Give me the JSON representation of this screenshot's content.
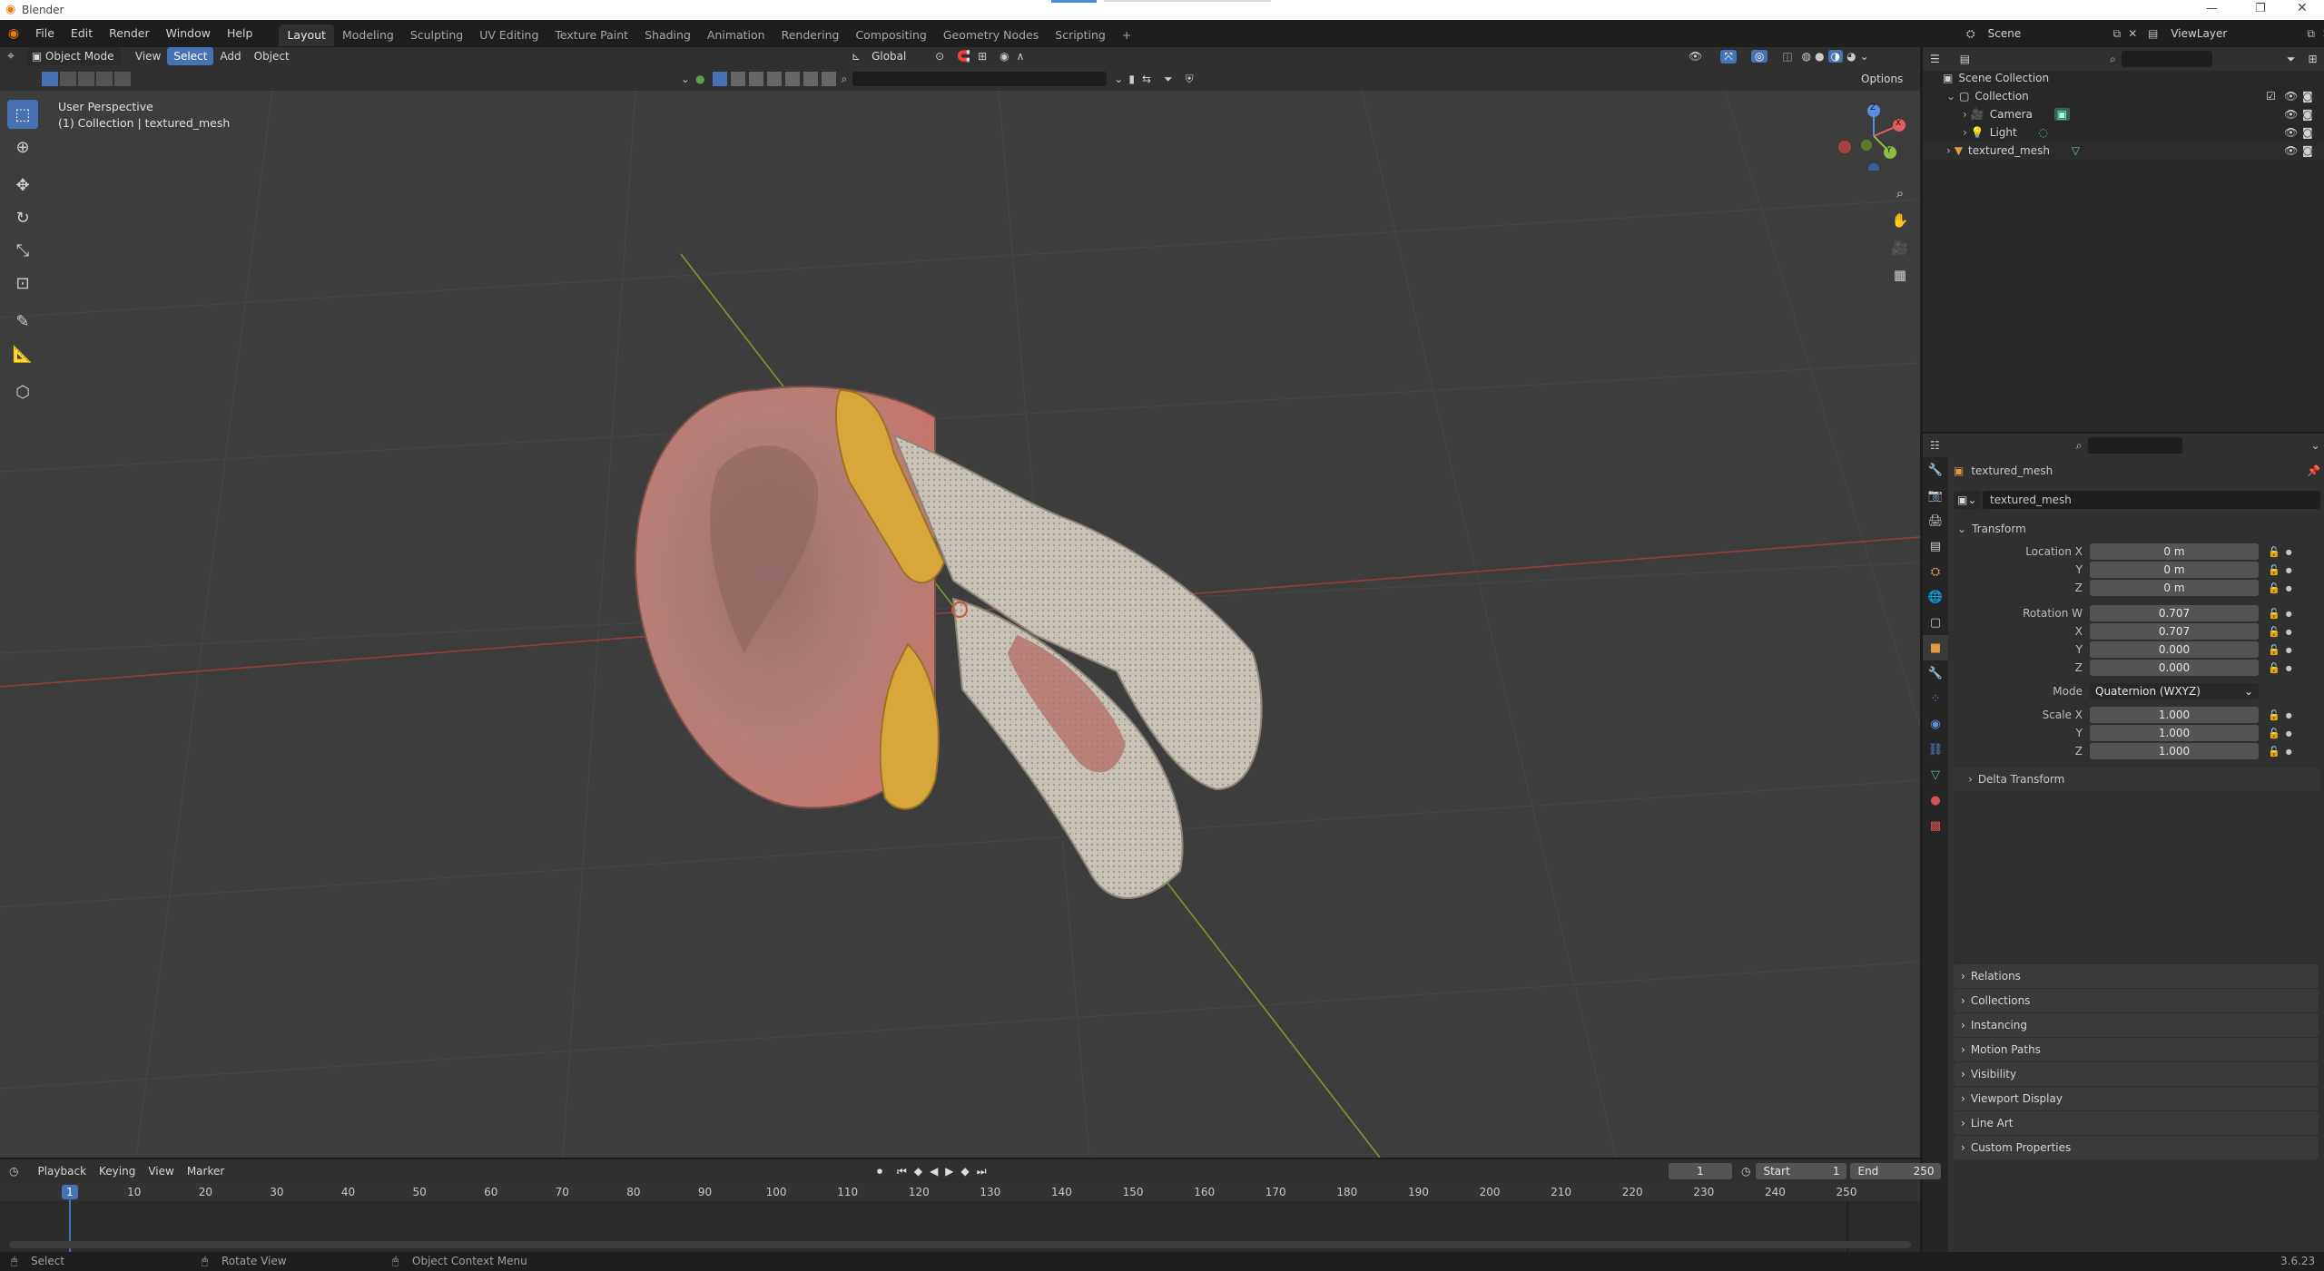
{
  "title_bar": {
    "app_name": "Blender"
  },
  "menu": {
    "items": [
      "File",
      "Edit",
      "Render",
      "Window",
      "Help"
    ]
  },
  "workspaces": {
    "tabs": [
      "Layout",
      "Modeling",
      "Sculpting",
      "UV Editing",
      "Texture Paint",
      "Shading",
      "Animation",
      "Rendering",
      "Compositing",
      "Geometry Nodes",
      "Scripting"
    ],
    "active": "Layout",
    "add_label": "+"
  },
  "scene": {
    "label": "Scene",
    "view_layer_label": "ViewLayer"
  },
  "viewport_header": {
    "mode": "Object Mode",
    "menus": [
      "View",
      "Select",
      "Add",
      "Object"
    ],
    "active_menu": "Select",
    "transform_orientation": "Global",
    "options_label": "Options"
  },
  "viewport": {
    "perspective_label": "User Perspective",
    "collection_label": "(1) Collection | textured_mesh",
    "gizmo_axes": {
      "x": "X",
      "y": "Y",
      "z": "Z"
    }
  },
  "outliner": {
    "root": "Scene Collection",
    "items": [
      {
        "label": "Collection",
        "level": 1
      },
      {
        "label": "Camera",
        "level": 2
      },
      {
        "label": "Light",
        "level": 2
      },
      {
        "label": "textured_mesh",
        "level": 1
      }
    ]
  },
  "properties": {
    "object_name": "textured_mesh",
    "data_name": "textured_mesh",
    "transform_label": "Transform",
    "location": {
      "label": "Location X",
      "x": "0 m",
      "y": "0 m",
      "z": "0 m"
    },
    "rotation": {
      "label": "Rotation W",
      "w": "0.707",
      "x": "0.707",
      "y": "0.000",
      "z": "0.000"
    },
    "mode": {
      "label": "Mode",
      "value": "Quaternion (WXYZ)"
    },
    "scale": {
      "label": "Scale X",
      "x": "1.000",
      "y": "1.000",
      "z": "1.000"
    },
    "axis_labels": {
      "x": "X",
      "y": "Y",
      "z": "Z"
    },
    "delta_transform": "Delta Transform",
    "panels": [
      "Relations",
      "Collections",
      "Instancing",
      "Motion Paths",
      "Visibility",
      "Viewport Display",
      "Line Art",
      "Custom Properties"
    ]
  },
  "timeline": {
    "menus": [
      "Playback",
      "Keying",
      "View",
      "Marker"
    ],
    "current_frame": "1",
    "start_label": "Start",
    "start_value": "1",
    "end_label": "End",
    "end_value": "250",
    "ruler": [
      "1",
      "10",
      "20",
      "30",
      "40",
      "50",
      "60",
      "70",
      "80",
      "90",
      "100",
      "110",
      "120",
      "130",
      "140",
      "150",
      "160",
      "170",
      "180",
      "190",
      "200",
      "210",
      "220",
      "230",
      "240",
      "250"
    ]
  },
  "status_bar": {
    "select": "Select",
    "rotate": "Rotate View",
    "context_menu": "Object Context Menu",
    "version": "3.6.23"
  },
  "colors": {
    "accent": "#4772b3",
    "x_axis": "#e06060",
    "y_axis": "#8fbd3f",
    "z_axis": "#5a8ee0"
  }
}
